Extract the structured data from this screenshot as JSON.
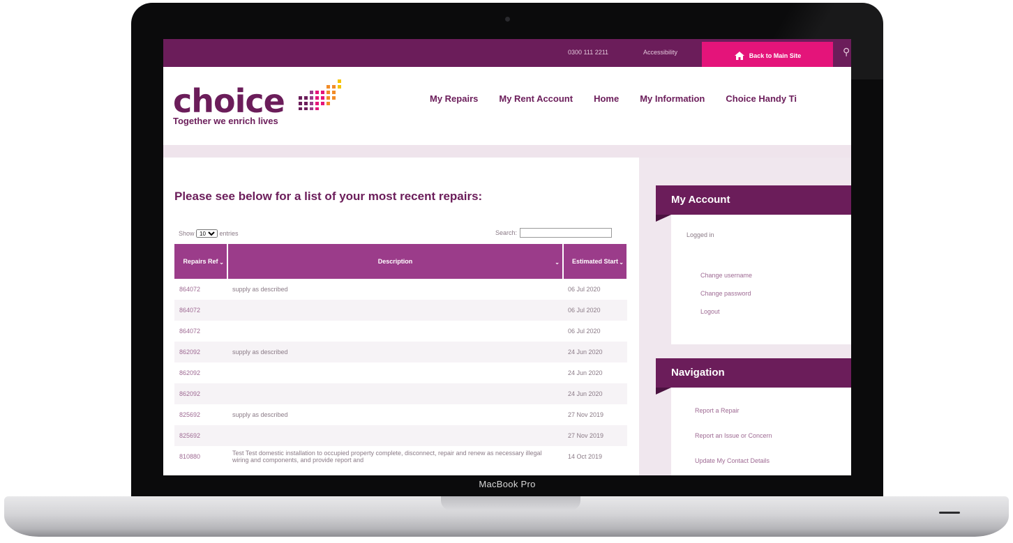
{
  "device": {
    "model_label": "MacBook Pro"
  },
  "topbar": {
    "phone": "0300 111 2211",
    "accessibility": "Accessibility",
    "back_button": "Back to Main Site"
  },
  "logo": {
    "wordmark": "choice",
    "tagline": "Together we enrich lives"
  },
  "nav": {
    "items": [
      "My Repairs",
      "My Rent Account",
      "Home",
      "My Information",
      "Choice Handy Ti"
    ]
  },
  "main": {
    "heading": "Please see below for a list of your most recent repairs:",
    "show_label": "Show",
    "entries_value": "10",
    "entries_label": "entries",
    "search_label": "Search:",
    "search_value": "",
    "columns": [
      "Repairs Ref",
      "Description",
      "Estimated Start"
    ],
    "rows": [
      {
        "ref": "864072",
        "desc": "supply as described",
        "date": "06 Jul 2020"
      },
      {
        "ref": "864072",
        "desc": "",
        "date": "06 Jul 2020"
      },
      {
        "ref": "864072",
        "desc": "",
        "date": "06 Jul 2020"
      },
      {
        "ref": "862092",
        "desc": "supply as described",
        "date": "24 Jun 2020"
      },
      {
        "ref": "862092",
        "desc": "",
        "date": "24 Jun 2020"
      },
      {
        "ref": "862092",
        "desc": "",
        "date": "24 Jun 2020"
      },
      {
        "ref": "825692",
        "desc": "supply as described",
        "date": "27 Nov 2019"
      },
      {
        "ref": "825692",
        "desc": "",
        "date": "27 Nov 2019"
      },
      {
        "ref": "810880",
        "desc": "Test Test domestic installation to occupied property complete, disconnect, repair and renew as necessary illegal wiring and components, and provide report and",
        "date": "14 Oct 2019"
      }
    ]
  },
  "sidebar": {
    "account_title": "My Account",
    "logged_in": "Logged in",
    "account_links": [
      "Change username",
      "Change password",
      "Logout"
    ],
    "nav_title": "Navigation",
    "nav_links": [
      "Report a Repair",
      "Report an Issue or Concern",
      "Update My Contact Details"
    ]
  },
  "colors": {
    "brand_purple": "#6b1d5a",
    "accent_pink": "#e4147a",
    "table_header": "#9b3c8a"
  }
}
